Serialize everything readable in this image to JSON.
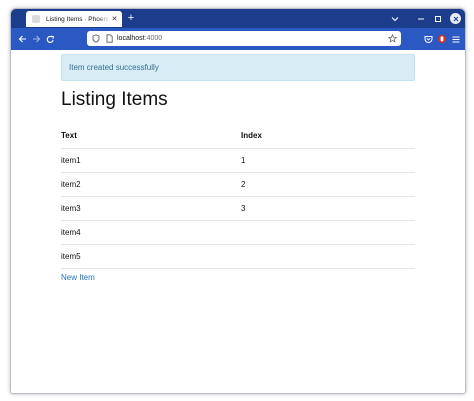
{
  "browser": {
    "tab": {
      "title": "Listing Items · Phoenix Framework"
    },
    "address": {
      "host": "localhost",
      "port": ":4000"
    },
    "colors": {
      "tab_strip": "#1c3d8c",
      "toolbar": "#2a59c4",
      "extension_badge": "#c5342f"
    },
    "icons": {
      "back": "arrow-left-icon",
      "forward": "arrow-right-icon",
      "reload": "reload-icon",
      "new_tab": "plus-icon",
      "tab_list": "chevron-down-icon",
      "minimize": "minimize-icon",
      "maximize": "maximize-icon",
      "close": "close-icon",
      "shield": "shield-icon",
      "page": "page-icon",
      "bookmark": "star-icon",
      "pocket": "pocket-icon",
      "extension": "extension-icon",
      "menu": "hamburger-menu-icon"
    }
  },
  "page": {
    "flash": "Item created successfully",
    "title": "Listing Items",
    "table": {
      "headers": [
        "Text",
        "Index"
      ],
      "rows": [
        {
          "text": "item1",
          "index": "1"
        },
        {
          "text": "item2",
          "index": "2"
        },
        {
          "text": "item3",
          "index": "3"
        },
        {
          "text": "item4",
          "index": ""
        },
        {
          "text": "item5",
          "index": ""
        }
      ]
    },
    "new_link": "New Item",
    "colors": {
      "flash_bg": "#d8ecf5",
      "flash_text": "#31708f",
      "link": "#2473b8"
    }
  }
}
